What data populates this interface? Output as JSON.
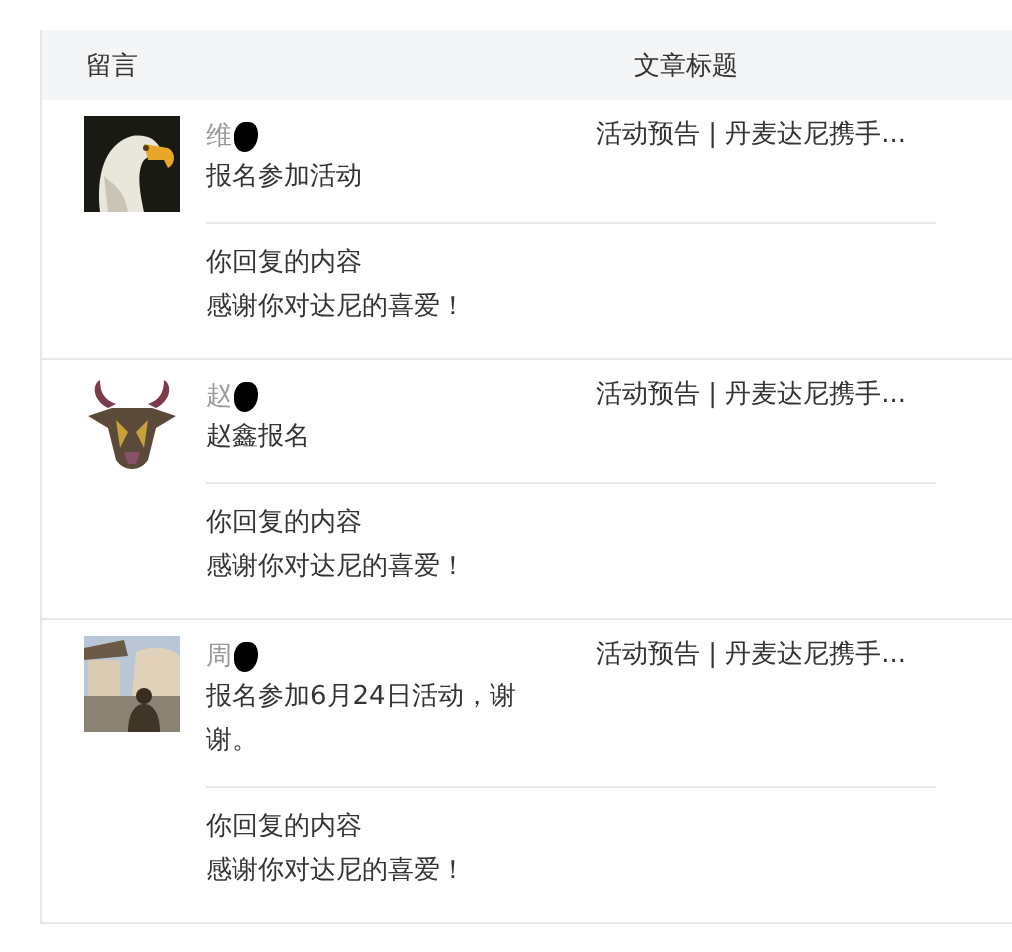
{
  "table": {
    "columns": [
      "留言",
      "文章标题"
    ],
    "rows": [
      {
        "name": "维",
        "message": "报名参加活动",
        "reply_label": "你回复的内容",
        "reply": "感谢你对达尼的喜爱！",
        "article": "活动预告 | 丹麦达尼携手..."
      },
      {
        "name": "赵",
        "message": "赵鑫报名",
        "reply_label": "你回复的内容",
        "reply": "感谢你对达尼的喜爱！",
        "article": "活动预告 | 丹麦达尼携手..."
      },
      {
        "name": "周",
        "message": "报名参加6月24日活动，谢谢。",
        "reply_label": "你回复的内容",
        "reply": "感谢你对达尼的喜爱！",
        "article": "活动预告 | 丹麦达尼携手..."
      }
    ]
  }
}
